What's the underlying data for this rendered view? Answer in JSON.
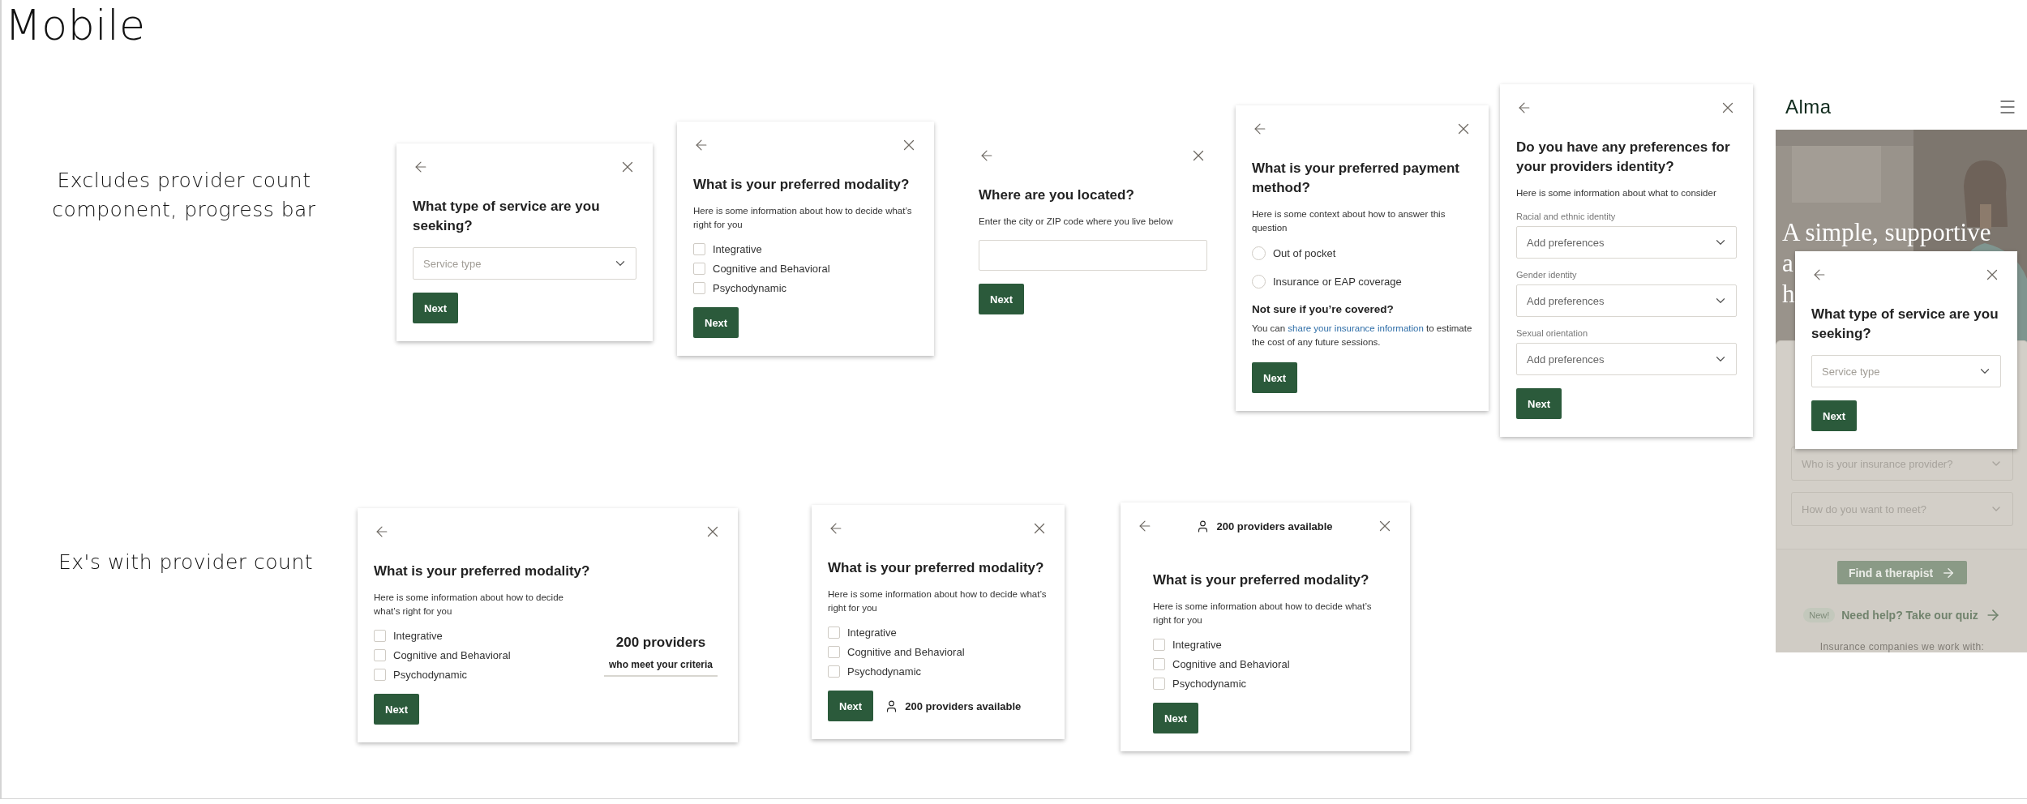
{
  "notes": {
    "title": "Mobile",
    "excludes_note": "Excludes provider count component, progress bar",
    "examples_note": "Ex's with provider count"
  },
  "cards": [
    {
      "elevated": true,
      "title": "What type of service are you seeking?",
      "fields": [
        {
          "kind": "select",
          "placeholder": "Service type"
        }
      ],
      "button": "Next"
    },
    {
      "elevated": true,
      "title": "What is your preferred modality?",
      "description": "Here is some information about how to decide what’s right for you",
      "fields": [
        {
          "kind": "checkbox",
          "label": "Integrative",
          "checked": false
        },
        {
          "kind": "checkbox",
          "label": "Cognitive and Behavioral",
          "checked": false
        },
        {
          "kind": "checkbox",
          "label": "Psychodynamic",
          "checked": false
        }
      ],
      "button": "Next"
    },
    {
      "elevated": false,
      "title": "Where are you located?",
      "description": "Enter the city or ZIP code where you live below",
      "fields": [
        {
          "kind": "text_input"
        }
      ],
      "button": "Next"
    },
    {
      "elevated": true,
      "title": "What is your preferred payment method?",
      "description": "Here is some context about how to answer this question",
      "fields": [
        {
          "kind": "radio",
          "label": "Out of pocket",
          "selected": false
        },
        {
          "kind": "radio",
          "label": "Insurance or EAP coverage",
          "selected": false
        }
      ],
      "help": {
        "heading": "Not sure if you’re covered?",
        "text_before": "You can ",
        "link": "share your insurance information",
        "text_after": " to estimate the cost of any future sessions."
      },
      "button": "Next"
    },
    {
      "elevated": true,
      "title": "Do you have any preferences for your providers identity?",
      "description": "Here is some information about what to consider",
      "fields": [
        {
          "kind": "select",
          "label": "Racial and ethnic identity",
          "placeholder": "Add preferences"
        },
        {
          "kind": "select",
          "label": "Gender identity",
          "placeholder": "Add preferences"
        },
        {
          "kind": "select",
          "label": "Sexual orientation",
          "placeholder": "Add preferences"
        }
      ],
      "button": "Next"
    },
    {
      "elevated": true,
      "title": "What is your preferred modality?",
      "description": "Here is some information about how to decide what’s right for you",
      "fields": [
        {
          "kind": "checkbox",
          "label": "Integrative",
          "checked": false
        },
        {
          "kind": "checkbox",
          "label": "Cognitive and Behavioral",
          "checked": false
        },
        {
          "kind": "checkbox",
          "label": "Psychodynamic",
          "checked": false
        }
      ],
      "side_count": {
        "number": "200 providers",
        "caption": "who meet your criteria"
      },
      "button": "Next"
    },
    {
      "elevated": true,
      "title": "What is your preferred modality?",
      "description": "Here is some information about how to decide what’s right for you",
      "fields": [
        {
          "kind": "checkbox",
          "label": "Integrative",
          "checked": false
        },
        {
          "kind": "checkbox",
          "label": "Cognitive and Behavioral",
          "checked": false
        },
        {
          "kind": "checkbox",
          "label": "Psychodynamic",
          "checked": false
        }
      ],
      "button": "Next",
      "footer_count": "200 providers available"
    },
    {
      "elevated": true,
      "header_count": "200 providers available",
      "title": "What is your preferred modality?",
      "description": "Here is some information about how to decide what’s right for you",
      "fields": [
        {
          "kind": "checkbox",
          "label": "Integrative",
          "checked": false
        },
        {
          "kind": "checkbox",
          "label": "Cognitive and Behavioral",
          "checked": false
        },
        {
          "kind": "checkbox",
          "label": "Psychodynamic",
          "checked": false
        }
      ],
      "button": "Next"
    }
  ],
  "phone": {
    "logo": "Alma",
    "hero_lines": [
      "A simple, supportive",
      "a",
      "h"
    ],
    "form_fields": [
      {
        "placeholder": "Who is your insurance provider?"
      },
      {
        "placeholder": "How do you want to meet?"
      }
    ],
    "cta": "Find a therapist",
    "badge": "New!",
    "quiz_link": "Need help? Take our quiz",
    "footnote": "Insurance companies we work with:",
    "modal": {
      "elevated": true,
      "title": "What type of service are you seeking?",
      "fields": [
        {
          "kind": "select",
          "placeholder": "Service type"
        }
      ],
      "button": "Next"
    }
  }
}
